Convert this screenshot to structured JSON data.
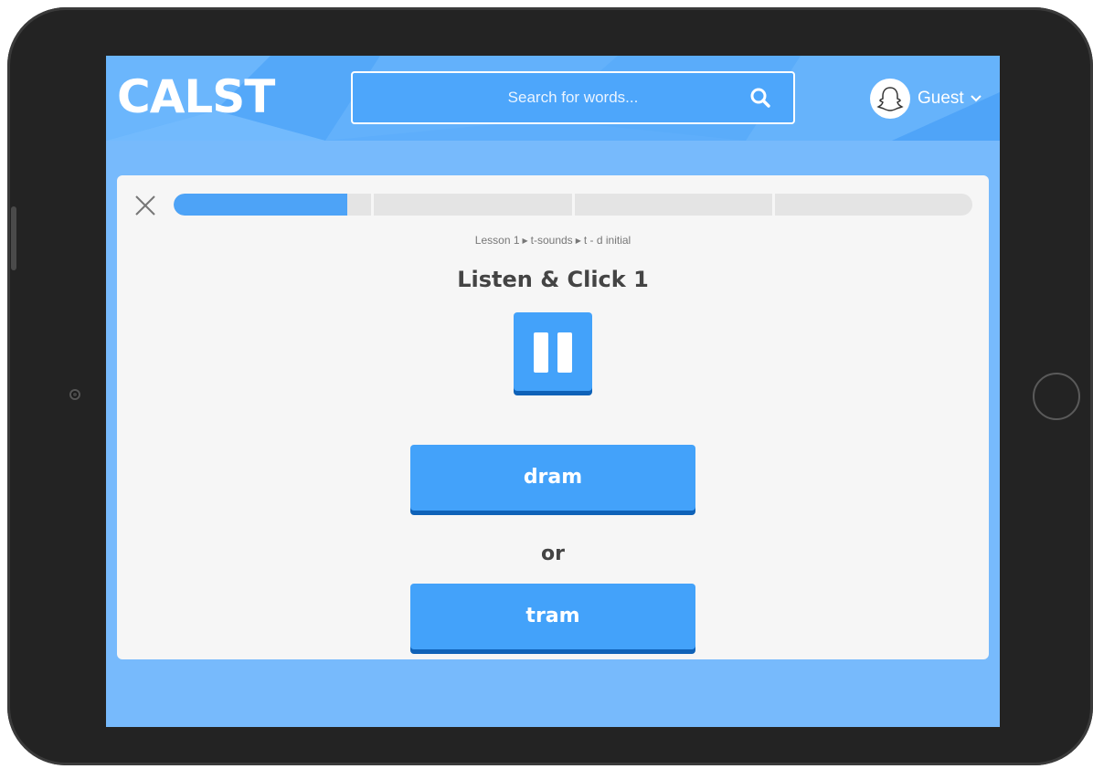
{
  "header": {
    "logo": "CALST",
    "search_placeholder": "Search for words...",
    "user_name": "Guest"
  },
  "exercise": {
    "progress": 0.22,
    "progress_segments": 4,
    "breadcrumb": [
      "Lesson 1",
      "t-sounds",
      "t - d initial"
    ],
    "title": "Listen & Click 1",
    "choices": [
      "dram",
      "tram"
    ],
    "or_label": "or"
  },
  "icons": {
    "search": "search-icon",
    "avatar": "ghost-icon",
    "chevron": "chevron-down-icon",
    "close": "close-icon",
    "pause": "pause-icon"
  },
  "colors": {
    "accent": "#43a2fa",
    "accent_shadow": "#0f62b8",
    "header": "#5eaefb",
    "background": "#77bafc",
    "card": "#f6f6f6"
  }
}
